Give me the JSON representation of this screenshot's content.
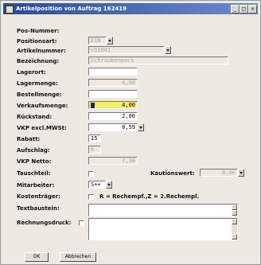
{
  "window": {
    "title": "Artikelposition von Auftrag 162419",
    "min_label": "_",
    "max_label": "□",
    "close_label": "×"
  },
  "form": {
    "pos_nummer": {
      "label": "Pos-Nummer:",
      "value": ""
    },
    "positionsart": {
      "label": "Positionsart:",
      "value": "EIN"
    },
    "artikelnummer": {
      "label": "Artikelnummer:",
      "value": "VS1041"
    },
    "bezeichnung": {
      "label": "Bezeichnung:",
      "value": "Schraubenpack"
    },
    "lagerort": {
      "label": "Lagerort:",
      "value": ""
    },
    "lagermenge": {
      "label": "Lagermenge:",
      "value": "4,00"
    },
    "bestellmenge": {
      "label": "Bestellmenge:",
      "value": ""
    },
    "verkaufsmenge": {
      "label": "Verkaufsmenge:",
      "value": "4,00"
    },
    "rueckstand": {
      "label": "Rückstand:",
      "value": "2,00"
    },
    "vkp_excl": {
      "label": "VKP excl.MWSt:",
      "value": "8,59"
    },
    "rabatt": {
      "label": "Rabatt:",
      "value": "15"
    },
    "aufschlag": {
      "label": "Aufschlag:",
      "value": "0"
    },
    "vkp_netto": {
      "label": "VKP Netto:",
      "value": "7,30"
    },
    "tauschteil": {
      "label": "Tauschteil:"
    },
    "kautionswert": {
      "label": "Kautionswert:",
      "value": "0,00"
    },
    "mitarbeiter": {
      "label": "Mitarbeiter:",
      "value": "S++"
    },
    "kostentraeger": {
      "label": "Kostenträger:",
      "hint": "R = Rechempf.,Z = 2.Rechempl."
    },
    "textbaustein": {
      "label": "Textbaustein:"
    },
    "rechnungsdruck": {
      "label": "Rechnungsdruck:"
    }
  },
  "buttons": {
    "ok": "OK",
    "abbrechen": "Abbrechen"
  },
  "colors": {
    "titlebar_start": "#2a4a9c",
    "titlebar_end": "#6d8bd0",
    "highlight_field": "#f4ee63",
    "dialog_bg": "#ece9e2"
  }
}
